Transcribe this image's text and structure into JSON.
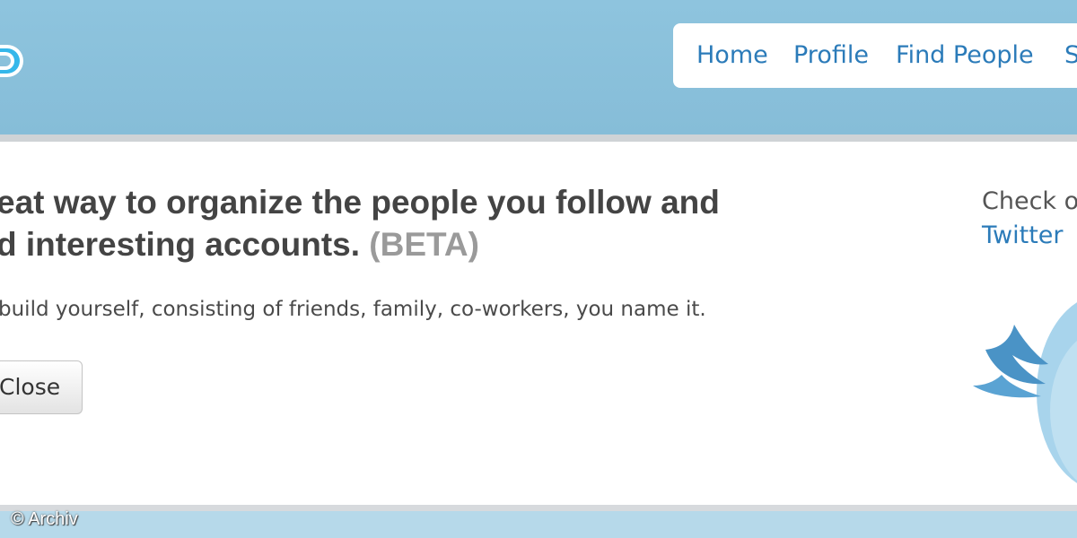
{
  "nav": {
    "home": "Home",
    "profile": "Profile",
    "find_people": "Find People",
    "next_partial": "S"
  },
  "intro": {
    "headline_line1": "eat way to organize the people you follow and",
    "headline_line2": "d interesting accounts.",
    "beta": "(BETA)",
    "subtext": "build yourself, consisting of friends, family, co-workers, you name it.",
    "close_button": "Close"
  },
  "sidebar": {
    "text": "Check o",
    "link": "Twitter"
  },
  "watermark": "© Archiv",
  "colors": {
    "header_bg": "#8ec4de",
    "link": "#2b7bb9",
    "headline": "#444444",
    "beta": "#9a9a9a",
    "logo": "#35b7ea",
    "bird_wing": "#4a93c6",
    "bird_body": "#9fd0ea"
  }
}
